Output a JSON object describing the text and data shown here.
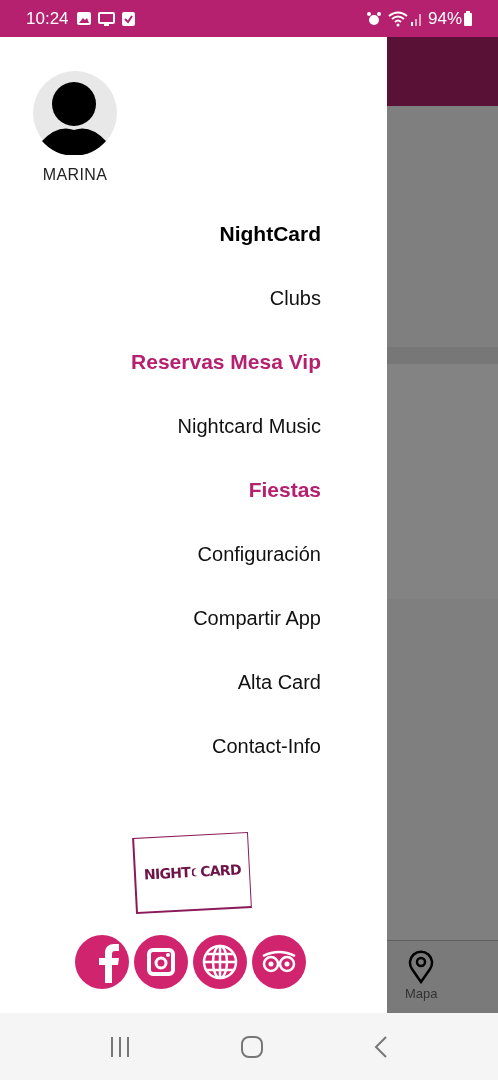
{
  "status_bar": {
    "time": "10:24",
    "battery": "94%"
  },
  "drawer": {
    "user_name": "MARINA",
    "menu": [
      {
        "label": "NightCard",
        "kind": "header"
      },
      {
        "label": "Clubs",
        "kind": "normal"
      },
      {
        "label": "Reservas Mesa Vip",
        "kind": "highlight"
      },
      {
        "label": "Nightcard Music",
        "kind": "normal"
      },
      {
        "label": "Fiestas",
        "kind": "highlight"
      },
      {
        "label": "Configuración",
        "kind": "normal"
      },
      {
        "label": "Compartir App",
        "kind": "normal"
      },
      {
        "label": "Alta Card",
        "kind": "normal"
      },
      {
        "label": "Contact-Info",
        "kind": "normal"
      }
    ],
    "logo_text": [
      "NIGHT",
      "CARD"
    ],
    "social": [
      {
        "kind": "facebook"
      },
      {
        "kind": "instagram"
      },
      {
        "kind": "web"
      },
      {
        "kind": "tripadvisor"
      }
    ]
  },
  "bottom_nav": {
    "items": [
      {
        "label": "Mapa"
      }
    ]
  }
}
